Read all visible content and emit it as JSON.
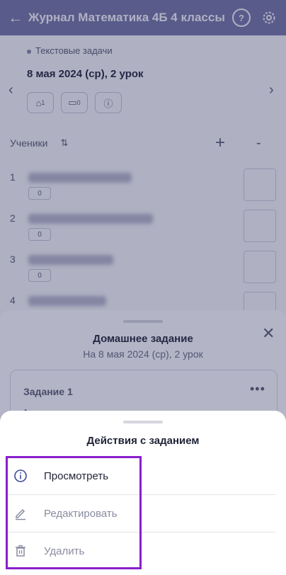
{
  "header": {
    "title": "Журнал Математика 4Б 4 классы"
  },
  "lesson": {
    "topic": "Текстовые задачи",
    "date": "8 мая 2024 (ср), 2 урок",
    "chips": [
      {
        "icon": "homework-icon",
        "count": "1"
      },
      {
        "icon": "comment-icon",
        "count": "0"
      },
      {
        "icon": "info-icon",
        "count": ""
      }
    ]
  },
  "students": {
    "label": "Ученики",
    "rows": [
      {
        "num": "1",
        "badge": "0"
      },
      {
        "num": "2",
        "badge": "0"
      },
      {
        "num": "3",
        "badge": "0"
      },
      {
        "num": "4",
        "badge": ""
      }
    ]
  },
  "homework_sheet": {
    "title": "Домашнее задание",
    "subtitle": "На 8 мая 2024 (ср), 2 урок",
    "task": {
      "title": "Задание 1",
      "number": "1"
    }
  },
  "actions_sheet": {
    "title": "Действия с заданием",
    "items": [
      {
        "label": "Просмотреть",
        "icon": "info-icon",
        "enabled": true
      },
      {
        "label": "Редактировать",
        "icon": "pencil-icon",
        "enabled": false
      },
      {
        "label": "Удалить",
        "icon": "trash-icon",
        "enabled": false
      }
    ]
  },
  "colors": {
    "header": "#7476a6",
    "highlight": "#8a1ecb",
    "enabled_icon": "#3b4a9c",
    "disabled": "#8a8ca0"
  }
}
